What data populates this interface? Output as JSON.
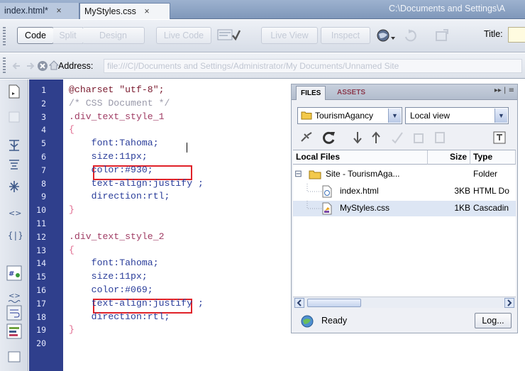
{
  "document_tabs": [
    {
      "label": "index.html*",
      "close": "×"
    },
    {
      "label": "MyStyles.css",
      "close": "×"
    }
  ],
  "path": "C:\\Documents and Settings\\A",
  "doc_toolbar": {
    "code": "Code",
    "split": "Split",
    "design": "Design",
    "live_code": "Live Code",
    "live_view": "Live View",
    "inspect": "Inspect",
    "title_label": "Title:",
    "title_value": ""
  },
  "address": {
    "label": "Address:",
    "value": "file:///C|/Documents and Settings/Administrator/My Documents/Unnamed Site"
  },
  "line_numbers": [
    "1",
    "2",
    "3",
    "4",
    "5",
    "6",
    "7",
    "8",
    "9",
    "10",
    "11",
    "12",
    "13",
    "14",
    "15",
    "16",
    "17",
    "18",
    "19",
    "20"
  ],
  "code_lines": [
    "@charset \"utf-8\";",
    "/* CSS Document */",
    ".div_text_style_1",
    "{",
    "    font:Tahoma;",
    "    size:11px;",
    "    color:#930;",
    "    text-align:justify ;",
    "    direction:rtl;",
    "}",
    "",
    ".div_text_style_2",
    "{",
    "    font:Tahoma;",
    "    size:11px;",
    "    color:#069;",
    "    text-align:justify ;",
    "    direction:rtl;",
    "}",
    ""
  ],
  "files_panel": {
    "tabs": [
      "FILES",
      "ASSETS"
    ],
    "menu": "▸▸ | ≡",
    "site": "TourismAgancy",
    "view": "Local view",
    "columns": {
      "local_files": "Local Files",
      "size": "Size",
      "type": "Type"
    },
    "rows": [
      {
        "name": "Site - TourismAga...",
        "size": "",
        "type": "Folder"
      },
      {
        "name": "index.html",
        "size": "3KB",
        "type": "HTML Do"
      },
      {
        "name": "MyStyles.css",
        "size": "1KB",
        "type": "Cascadin"
      }
    ],
    "expand_symbol": "⊟",
    "status": "Ready",
    "log_button": "Log..."
  },
  "colors": {
    "gutter": "#2f3f8c",
    "highlight_box": "#e02128",
    "selector": "#a03c64",
    "property": "#2a3d9a"
  }
}
